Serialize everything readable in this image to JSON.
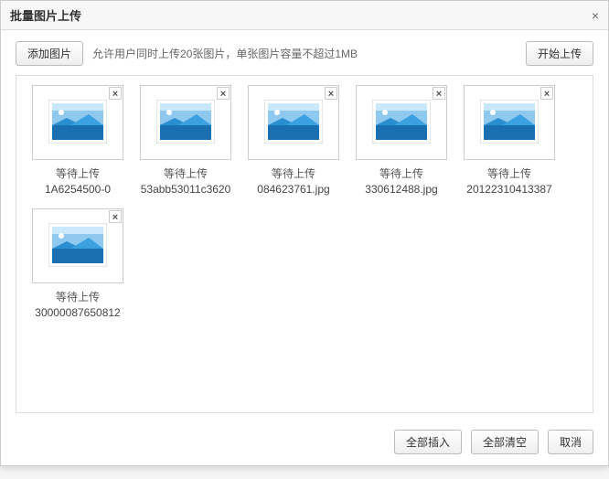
{
  "dialog": {
    "title": "批量图片上传",
    "close_glyph": "×"
  },
  "toolbar": {
    "add_label": "添加图片",
    "hint": "允许用户同时上传20张图片，单张图片容量不超过1MB",
    "start_label": "开始上传"
  },
  "items": [
    {
      "status": "等待上传",
      "filename": "1A6254500-0"
    },
    {
      "status": "等待上传",
      "filename": "53abb53011c3620"
    },
    {
      "status": "等待上传",
      "filename": "084623761.jpg"
    },
    {
      "status": "等待上传",
      "filename": "330612488.jpg"
    },
    {
      "status": "等待上传",
      "filename": "20122310413387"
    },
    {
      "status": "等待上传",
      "filename": "30000087650812"
    }
  ],
  "item_remove_glyph": "×",
  "footer": {
    "insert_all": "全部插入",
    "clear_all": "全部清空",
    "cancel": "取消"
  }
}
